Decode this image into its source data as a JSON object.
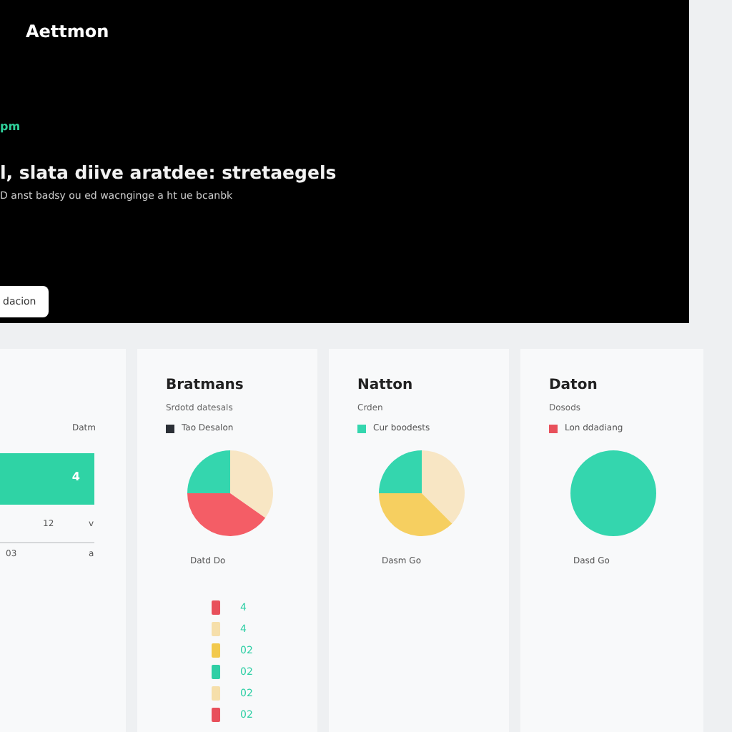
{
  "hero": {
    "brand": "Aettmon",
    "tag": "pm",
    "headline": "l, slata diive aratdee: stretaegels",
    "subtitle": "D anst badsy ou ed wacnginge a ht ue bcanbk",
    "button": "dacion"
  },
  "side_card": {
    "label": "Datm",
    "bar_label": "4",
    "ticks": [
      "12",
      "v"
    ],
    "axis": [
      "03",
      "a"
    ]
  },
  "cards": [
    {
      "title": "Bratmans",
      "subtitle": "Srdotd datesals",
      "legend": {
        "color": "#2b2f36",
        "label": "Tao Desalon"
      },
      "kind": "split-pie",
      "slices": [
        {
          "color": "#34d6ae"
        },
        {
          "color": "#f8e6c4"
        },
        {
          "color": "#f45d66"
        }
      ],
      "caption": "Datd Do",
      "bars": [
        {
          "color": "#e8505b",
          "value": "4"
        },
        {
          "color": "#f6dfaa",
          "value": "4"
        },
        {
          "color": "#f2c94c",
          "value": "02"
        },
        {
          "color": "#2fcfa5",
          "value": "02"
        },
        {
          "color": "#f6dfaa",
          "value": "02"
        },
        {
          "color": "#e8505b",
          "value": "02"
        }
      ]
    },
    {
      "title": "Natton",
      "subtitle": "Crden",
      "legend": {
        "color": "#34d6ae",
        "label": "Cur boodests"
      },
      "kind": "split-pie",
      "slices": [
        {
          "color": "#34d6ae"
        },
        {
          "color": "#f8e6c4"
        },
        {
          "color": "#f6cf60"
        }
      ],
      "caption": "Dasm Go"
    },
    {
      "title": "Daton",
      "subtitle": "Dosods",
      "legend": {
        "color": "#e8505b",
        "label": "Lon ddadiang"
      },
      "kind": "full-pie",
      "slices": [
        {
          "color": "#34d6ae"
        }
      ],
      "caption": "Dasd Go"
    }
  ]
}
